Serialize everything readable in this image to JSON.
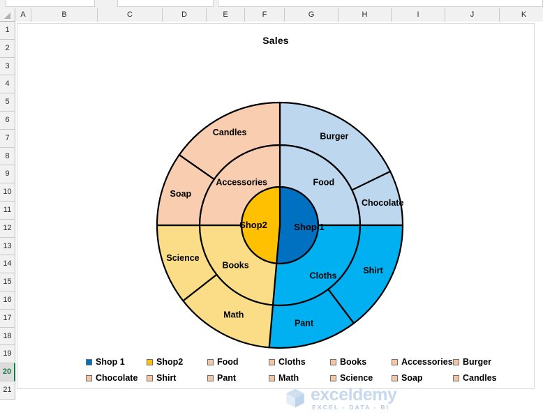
{
  "app": {
    "name": "Microsoft Excel",
    "selected_row": "20"
  },
  "grid": {
    "columns": [
      "A",
      "B",
      "C",
      "D",
      "E",
      "F",
      "G",
      "H",
      "I",
      "J",
      "K"
    ],
    "rows": [
      "1",
      "2",
      "3",
      "4",
      "5",
      "6",
      "7",
      "8",
      "9",
      "10",
      "11",
      "12",
      "13",
      "14",
      "15",
      "16",
      "17",
      "18",
      "19",
      "20",
      "21"
    ]
  },
  "chart": {
    "title": "Sales",
    "type": "sunburst"
  },
  "watermark": {
    "word": "exceldemy",
    "sub": "EXCEL - DATA - BI"
  },
  "legend": {
    "items": [
      {
        "label": "Shop 1",
        "color": "#0070c0"
      },
      {
        "label": "Shop2",
        "color": "#ffc000"
      },
      {
        "label": "Food",
        "color": "#f6c5a0"
      },
      {
        "label": "Cloths",
        "color": "#f6c5a0"
      },
      {
        "label": "Books",
        "color": "#f6c5a0"
      },
      {
        "label": "Accessories",
        "color": "#f6c5a0"
      },
      {
        "label": "Burger",
        "color": "#f6c5a0"
      },
      {
        "label": "Chocolate",
        "color": "#f6c5a0"
      },
      {
        "label": "Shirt",
        "color": "#f6c5a0"
      },
      {
        "label": "Pant",
        "color": "#f6c5a0"
      },
      {
        "label": "Math",
        "color": "#f6c5a0"
      },
      {
        "label": "Science",
        "color": "#f6c5a0"
      },
      {
        "label": "Soap",
        "color": "#f6c5a0"
      },
      {
        "label": "Candles",
        "color": "#f6c5a0"
      }
    ]
  },
  "chart_data": {
    "type": "pie",
    "subtype": "sunburst",
    "title": "Sales",
    "xlabel": "",
    "ylabel": "",
    "legend_position": "bottom",
    "grid": false,
    "levels": 3,
    "rings": [
      {
        "level": 1,
        "name": "Shop",
        "slices": [
          {
            "label": "Shop 1",
            "value": 185,
            "share_pct": 51.4,
            "color": "#0070c0",
            "start_deg": 0,
            "end_deg": 185
          },
          {
            "label": "Shop2",
            "value": 175,
            "share_pct": 48.6,
            "color": "#ffc000",
            "start_deg": 185,
            "end_deg": 360
          }
        ]
      },
      {
        "level": 2,
        "name": "Category",
        "slices": [
          {
            "label": "Food",
            "parent": "Shop 1",
            "value": 90,
            "share_pct": 25.0,
            "color": "#bdd7ee",
            "start_deg": 0,
            "end_deg": 90
          },
          {
            "label": "Cloths",
            "parent": "Shop 1",
            "value": 95,
            "share_pct": 26.4,
            "color": "#00b0f0",
            "start_deg": 90,
            "end_deg": 185
          },
          {
            "label": "Books",
            "parent": "Shop2",
            "value": 85,
            "share_pct": 23.6,
            "color": "#fadd86",
            "start_deg": 185,
            "end_deg": 270
          },
          {
            "label": "Accessories",
            "parent": "Shop2",
            "value": 90,
            "share_pct": 25.0,
            "color": "#f8cdb0",
            "start_deg": 270,
            "end_deg": 360
          }
        ]
      },
      {
        "level": 3,
        "name": "Item",
        "slices": [
          {
            "label": "Burger",
            "parent": "Food",
            "value": 64,
            "share_pct": 17.8,
            "color": "#bdd7ee",
            "start_deg": 0,
            "end_deg": 64
          },
          {
            "label": "Chocolate",
            "parent": "Food",
            "value": 26,
            "share_pct": 7.2,
            "color": "#bdd7ee",
            "start_deg": 64,
            "end_deg": 90
          },
          {
            "label": "Shirt",
            "parent": "Cloths",
            "value": 53,
            "share_pct": 14.7,
            "color": "#00b0f0",
            "start_deg": 90,
            "end_deg": 143
          },
          {
            "label": "Pant",
            "parent": "Cloths",
            "value": 42,
            "share_pct": 11.7,
            "color": "#00b0f0",
            "start_deg": 143,
            "end_deg": 185
          },
          {
            "label": "Math",
            "parent": "Books",
            "value": 47,
            "share_pct": 13.1,
            "color": "#fadd86",
            "start_deg": 185,
            "end_deg": 232
          },
          {
            "label": "Science",
            "parent": "Books",
            "value": 38,
            "share_pct": 10.6,
            "color": "#fadd86",
            "start_deg": 232,
            "end_deg": 270
          },
          {
            "label": "Soap",
            "parent": "Accessories",
            "value": 35,
            "share_pct": 9.7,
            "color": "#f8cdb0",
            "start_deg": 270,
            "end_deg": 305
          },
          {
            "label": "Candles",
            "parent": "Accessories",
            "value": 55,
            "share_pct": 15.3,
            "color": "#f8cdb0",
            "start_deg": 305,
            "end_deg": 360
          }
        ]
      }
    ],
    "labels": {
      "ring1": [
        "Shop 1",
        "Shop2"
      ],
      "ring2": [
        "Food",
        "Cloths",
        "Books",
        "Accessories"
      ],
      "ring3": [
        "Burger",
        "Chocolate",
        "Shirt",
        "Pant",
        "Math",
        "Science",
        "Soap",
        "Candles"
      ]
    }
  },
  "colors": {
    "shop1": "#0070c0",
    "shop2": "#ffc000",
    "food": "#bdd7ee",
    "cloths": "#00b0f0",
    "books": "#fadd86",
    "accessories": "#f8cdb0",
    "outline": "#000000",
    "legend_swatch_default": "#f6c5a0",
    "selection_green": "#217346"
  }
}
